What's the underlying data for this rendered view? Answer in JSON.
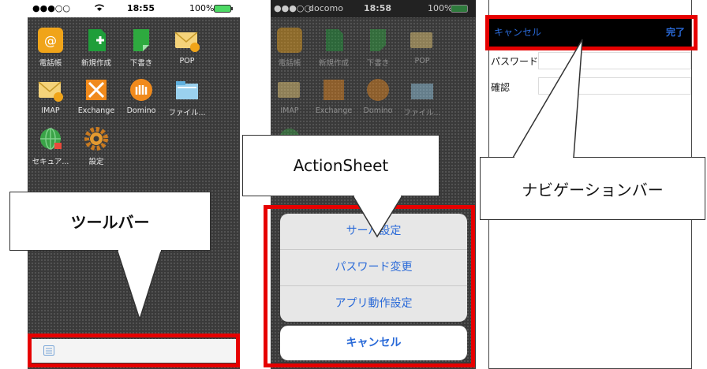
{
  "panel1": {
    "status": {
      "signal": "●●●○○",
      "wifi": "wifi",
      "time": "18:55",
      "battery": "100%"
    },
    "apps": [
      {
        "label": "電話帳",
        "icon": "address-book-icon"
      },
      {
        "label": "新規作成",
        "icon": "new-document-icon"
      },
      {
        "label": "下書き",
        "icon": "draft-icon"
      },
      {
        "label": "POP",
        "icon": "pop-mail-icon"
      },
      {
        "label": "IMAP",
        "icon": "imap-mail-icon"
      },
      {
        "label": "Exchange",
        "icon": "exchange-icon"
      },
      {
        "label": "Domino",
        "icon": "domino-icon"
      },
      {
        "label": "ファイル...",
        "icon": "file-icon"
      },
      {
        "label": "セキュア...",
        "icon": "secure-globe-icon"
      },
      {
        "label": "設定",
        "icon": "settings-gear-icon"
      }
    ],
    "callout": "ツールバー"
  },
  "panel2": {
    "status": {
      "signal": "●●●○○",
      "carrier": "docomo",
      "time": "18:58",
      "battery": "100%"
    },
    "apps": [
      "電話帳",
      "新規作成",
      "下書き",
      "POP",
      "IMAP",
      "Exchange",
      "Domino",
      "ファイル..."
    ],
    "callout": "ActionSheet",
    "sheet": {
      "items": [
        "サーバ設定",
        "パスワード変更",
        "アプリ動作設定"
      ],
      "cancel": "キャンセル"
    }
  },
  "panel3": {
    "nav": {
      "cancel": "キャンセル",
      "done": "完了"
    },
    "fields": {
      "password": "パスワード",
      "confirm": "確認"
    },
    "callout": "ナビゲーションバー"
  },
  "colors": {
    "highlight": "#e60000",
    "ios_blue": "#2a6ad8",
    "navbar": "#000000"
  }
}
